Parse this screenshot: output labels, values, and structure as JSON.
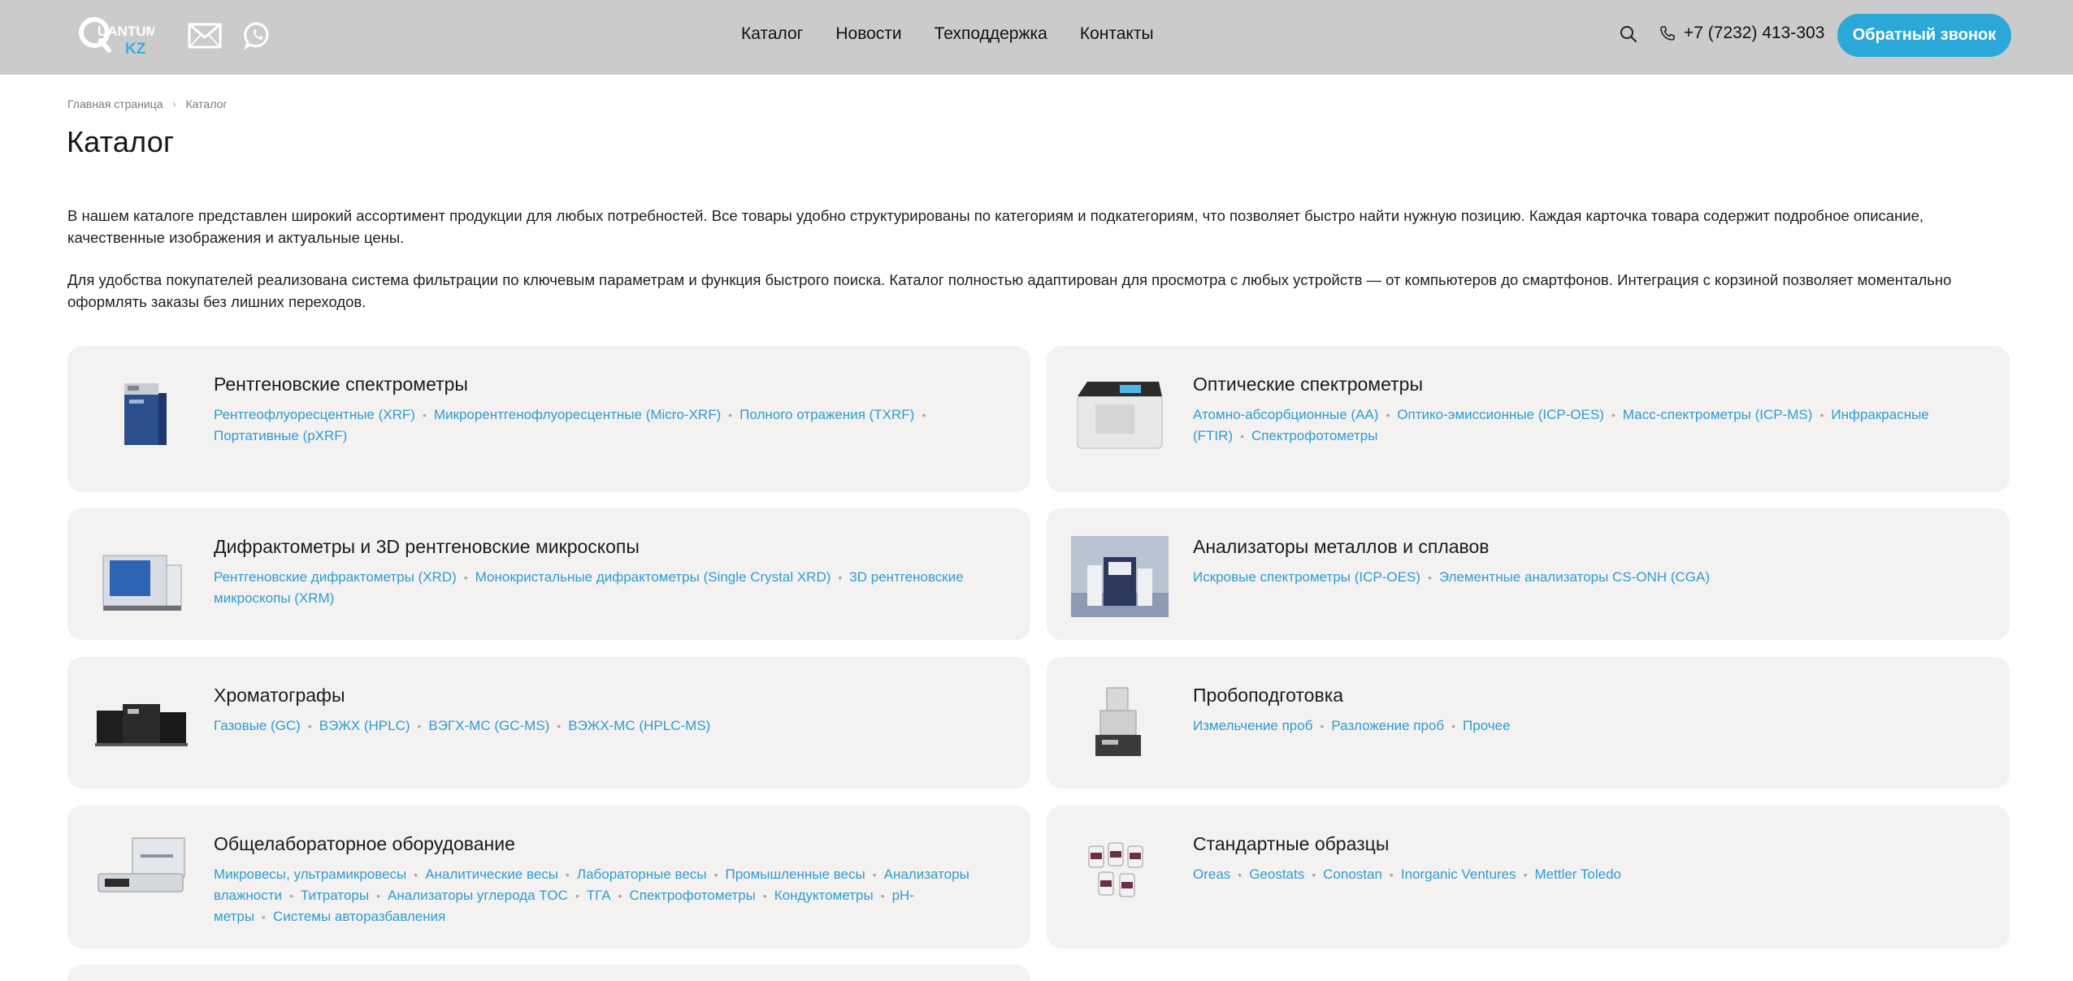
{
  "header": {
    "logo_text_top": "UANTUM",
    "logo_text_bottom": "KZ",
    "nav": [
      "Каталог",
      "Новости",
      "Техподдержка",
      "Контакты"
    ],
    "phone": "+7 (7232) 413-303",
    "callback_label": "Обратный звонок"
  },
  "breadcrumb": [
    "Главная страница",
    "Каталог"
  ],
  "page_title": "Каталог",
  "intro": [
    "В нашем каталоге представлен широкий ассортимент продукции для любых потребностей. Все товары удобно структурированы по категориям и подкатегориям, что позволяет быстро найти нужную позицию. Каждая карточка товара содержит подробное описание, качественные изображения и актуальные цены.",
    "Для удобства покупателей реализована система фильтрации по ключевым параметрам и функция быстрого поиска. Каталог полностью адаптирован для просмотра с любых устройств — от компьютеров до смартфонов. Интеграция с корзиной позволяет моментально оформлять заказы без лишних переходов."
  ],
  "categories": [
    {
      "title": "Рентгеновские спектрометры",
      "links": [
        "Рентгеофлуоресцентные (XRF)",
        "Микрорентгенофлуоресцентные (Micro-XRF)",
        "Полного отражения (TXRF)",
        "Портативные (pXRF)"
      ]
    },
    {
      "title": "Оптические спектрометры",
      "links": [
        "Атомно-абсорбционные (AA)",
        "Оптико-эмиссионные (ICP-OES)",
        "Масс-спектрометры (ICP-MS)",
        "Инфракрасные (FTIR)",
        "Спектрофотометры"
      ]
    },
    {
      "title": "Дифрактометры и 3D рентгеновские микроскопы",
      "links": [
        "Рентгеновские дифрактометры (XRD)",
        "Монокристальные дифрактометры (Single Crystal XRD)",
        "3D рентгеновские микроскопы (XRM)"
      ]
    },
    {
      "title": "Анализаторы металлов и сплавов",
      "links": [
        "Искровые спектрометры (ICP-OES)",
        "Элементные анализаторы CS-ONH (CGA)"
      ]
    },
    {
      "title": "Хроматографы",
      "links": [
        "Газовые (GC)",
        "ВЭЖХ (HPLC)",
        "ВЭГХ-МС (GC-MS)",
        "ВЭЖХ-МС (HPLC-MS)"
      ]
    },
    {
      "title": "Пробоподготовка",
      "links": [
        "Измельчение проб",
        "Разложение проб",
        "Прочее"
      ]
    },
    {
      "title": "Общелабораторное оборудование",
      "links": [
        "Микровесы, ультрамикровесы",
        "Аналитические весы",
        "Лабораторные весы",
        "Промышленные весы",
        "Анализаторы влажности",
        "Титраторы",
        "Анализаторы углерода TOC",
        "ТГА",
        "Спектрофотометры",
        "Кондуктометры",
        "pH-метры",
        "Системы авторазбавления"
      ]
    },
    {
      "title": "Стандартные образцы",
      "links": [
        "Oreas",
        "Geostats",
        "Conostan",
        "Inorganic Ventures",
        "Mettler Toledo"
      ]
    }
  ],
  "colors": {
    "header_bg": "#cbcbcb",
    "accent": "#2ba8d8",
    "link": "#2f9ccf",
    "card_bg": "#f3f2f1"
  }
}
